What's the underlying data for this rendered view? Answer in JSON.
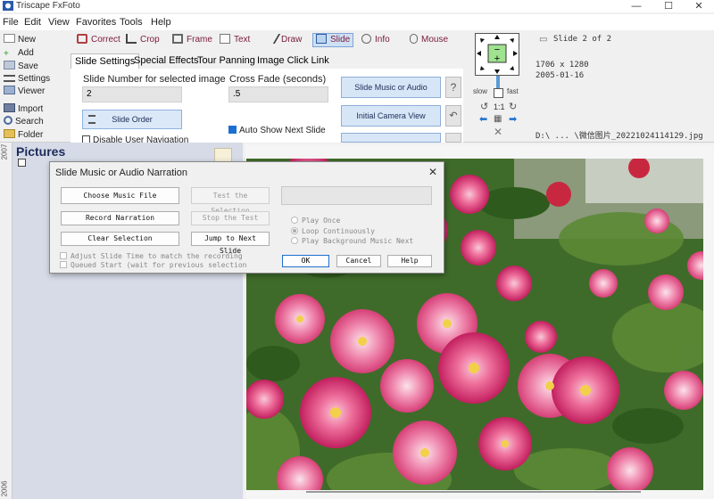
{
  "window": {
    "title": "Triscape FxFoto",
    "minimize": "—",
    "maximize": "☐",
    "close": "✕"
  },
  "menu": [
    "File",
    "Edit",
    "View",
    "Favorites",
    "Tools",
    "Help"
  ],
  "sidebar": {
    "items": [
      {
        "label": "New",
        "icon": "new-icon"
      },
      {
        "label": "Add",
        "icon": "add-icon"
      },
      {
        "label": "Save",
        "icon": "save-icon"
      },
      {
        "label": "Settings",
        "icon": "settings-icon"
      },
      {
        "label": "Viewer",
        "icon": "viewer-icon"
      },
      {
        "label": "Import",
        "icon": "import-icon"
      },
      {
        "label": "Search",
        "icon": "search-icon"
      },
      {
        "label": "Folder",
        "icon": "folder-icon"
      }
    ]
  },
  "tools": [
    {
      "label": "Correct",
      "icon": "correct-icon"
    },
    {
      "label": "Crop",
      "icon": "crop-icon"
    },
    {
      "label": "Frame",
      "icon": "frame-icon"
    },
    {
      "label": "Text",
      "icon": "text-icon"
    },
    {
      "label": "Draw",
      "icon": "draw-icon"
    },
    {
      "label": "Slide",
      "icon": "slide-icon"
    },
    {
      "label": "Info",
      "icon": "info-icon"
    },
    {
      "label": "Mouse",
      "icon": "mouse-icon"
    }
  ],
  "tabs": [
    "Slide Settings",
    "Special Effects",
    "Tour Panning",
    "Image Click Link"
  ],
  "slide_settings": {
    "slide_number_label": "Slide Number for selected image",
    "slide_number_value": "2",
    "cross_fade_label": "Cross Fade  (seconds)",
    "cross_fade_value": ".5",
    "slide_order": "Slide Order",
    "disable_nav": "Disable User Navigation",
    "auto_show_next": "Auto Show Next Slide",
    "slide_music": "Slide Music or Audio",
    "initial_camera": "Initial Camera View",
    "help_q": "?"
  },
  "navigator": {
    "slow": "slow",
    "fast": "fast",
    "one_to_one": "1:1"
  },
  "info_panel": {
    "slide_of": "Slide 2 of 2",
    "dimensions": "1706 x 1280",
    "date": "2005-01-16",
    "path": "D:\\ ... \\微信图片_20221024114129.jpg"
  },
  "left_panel": {
    "title": "Pictures",
    "ruler_top": "2007",
    "ruler_bottom": "2006"
  },
  "dialog": {
    "title": "Slide Music or Audio Narration",
    "close": "✕",
    "choose_music": "Choose Music File",
    "record_narration": "Record Narration",
    "clear_selection": "Clear Selection",
    "test_selection": "Test the Selection",
    "stop_test": "Stop the Test",
    "jump_next": "Jump to Next Slide",
    "play_once": "Play Once",
    "loop": "Loop Continuously",
    "play_background": "Play Background Music Next",
    "adjust_time": "Adjust Slide Time to match the recording",
    "queued_start": "Queued Start  (wait for previous selection",
    "ok": "OK",
    "cancel": "Cancel",
    "help": "Help",
    "music_path": ""
  },
  "colors": {
    "accent": "#1c6fd1",
    "tool_text": "#7a1a3a",
    "panel_bg": "#d6dbe7"
  }
}
